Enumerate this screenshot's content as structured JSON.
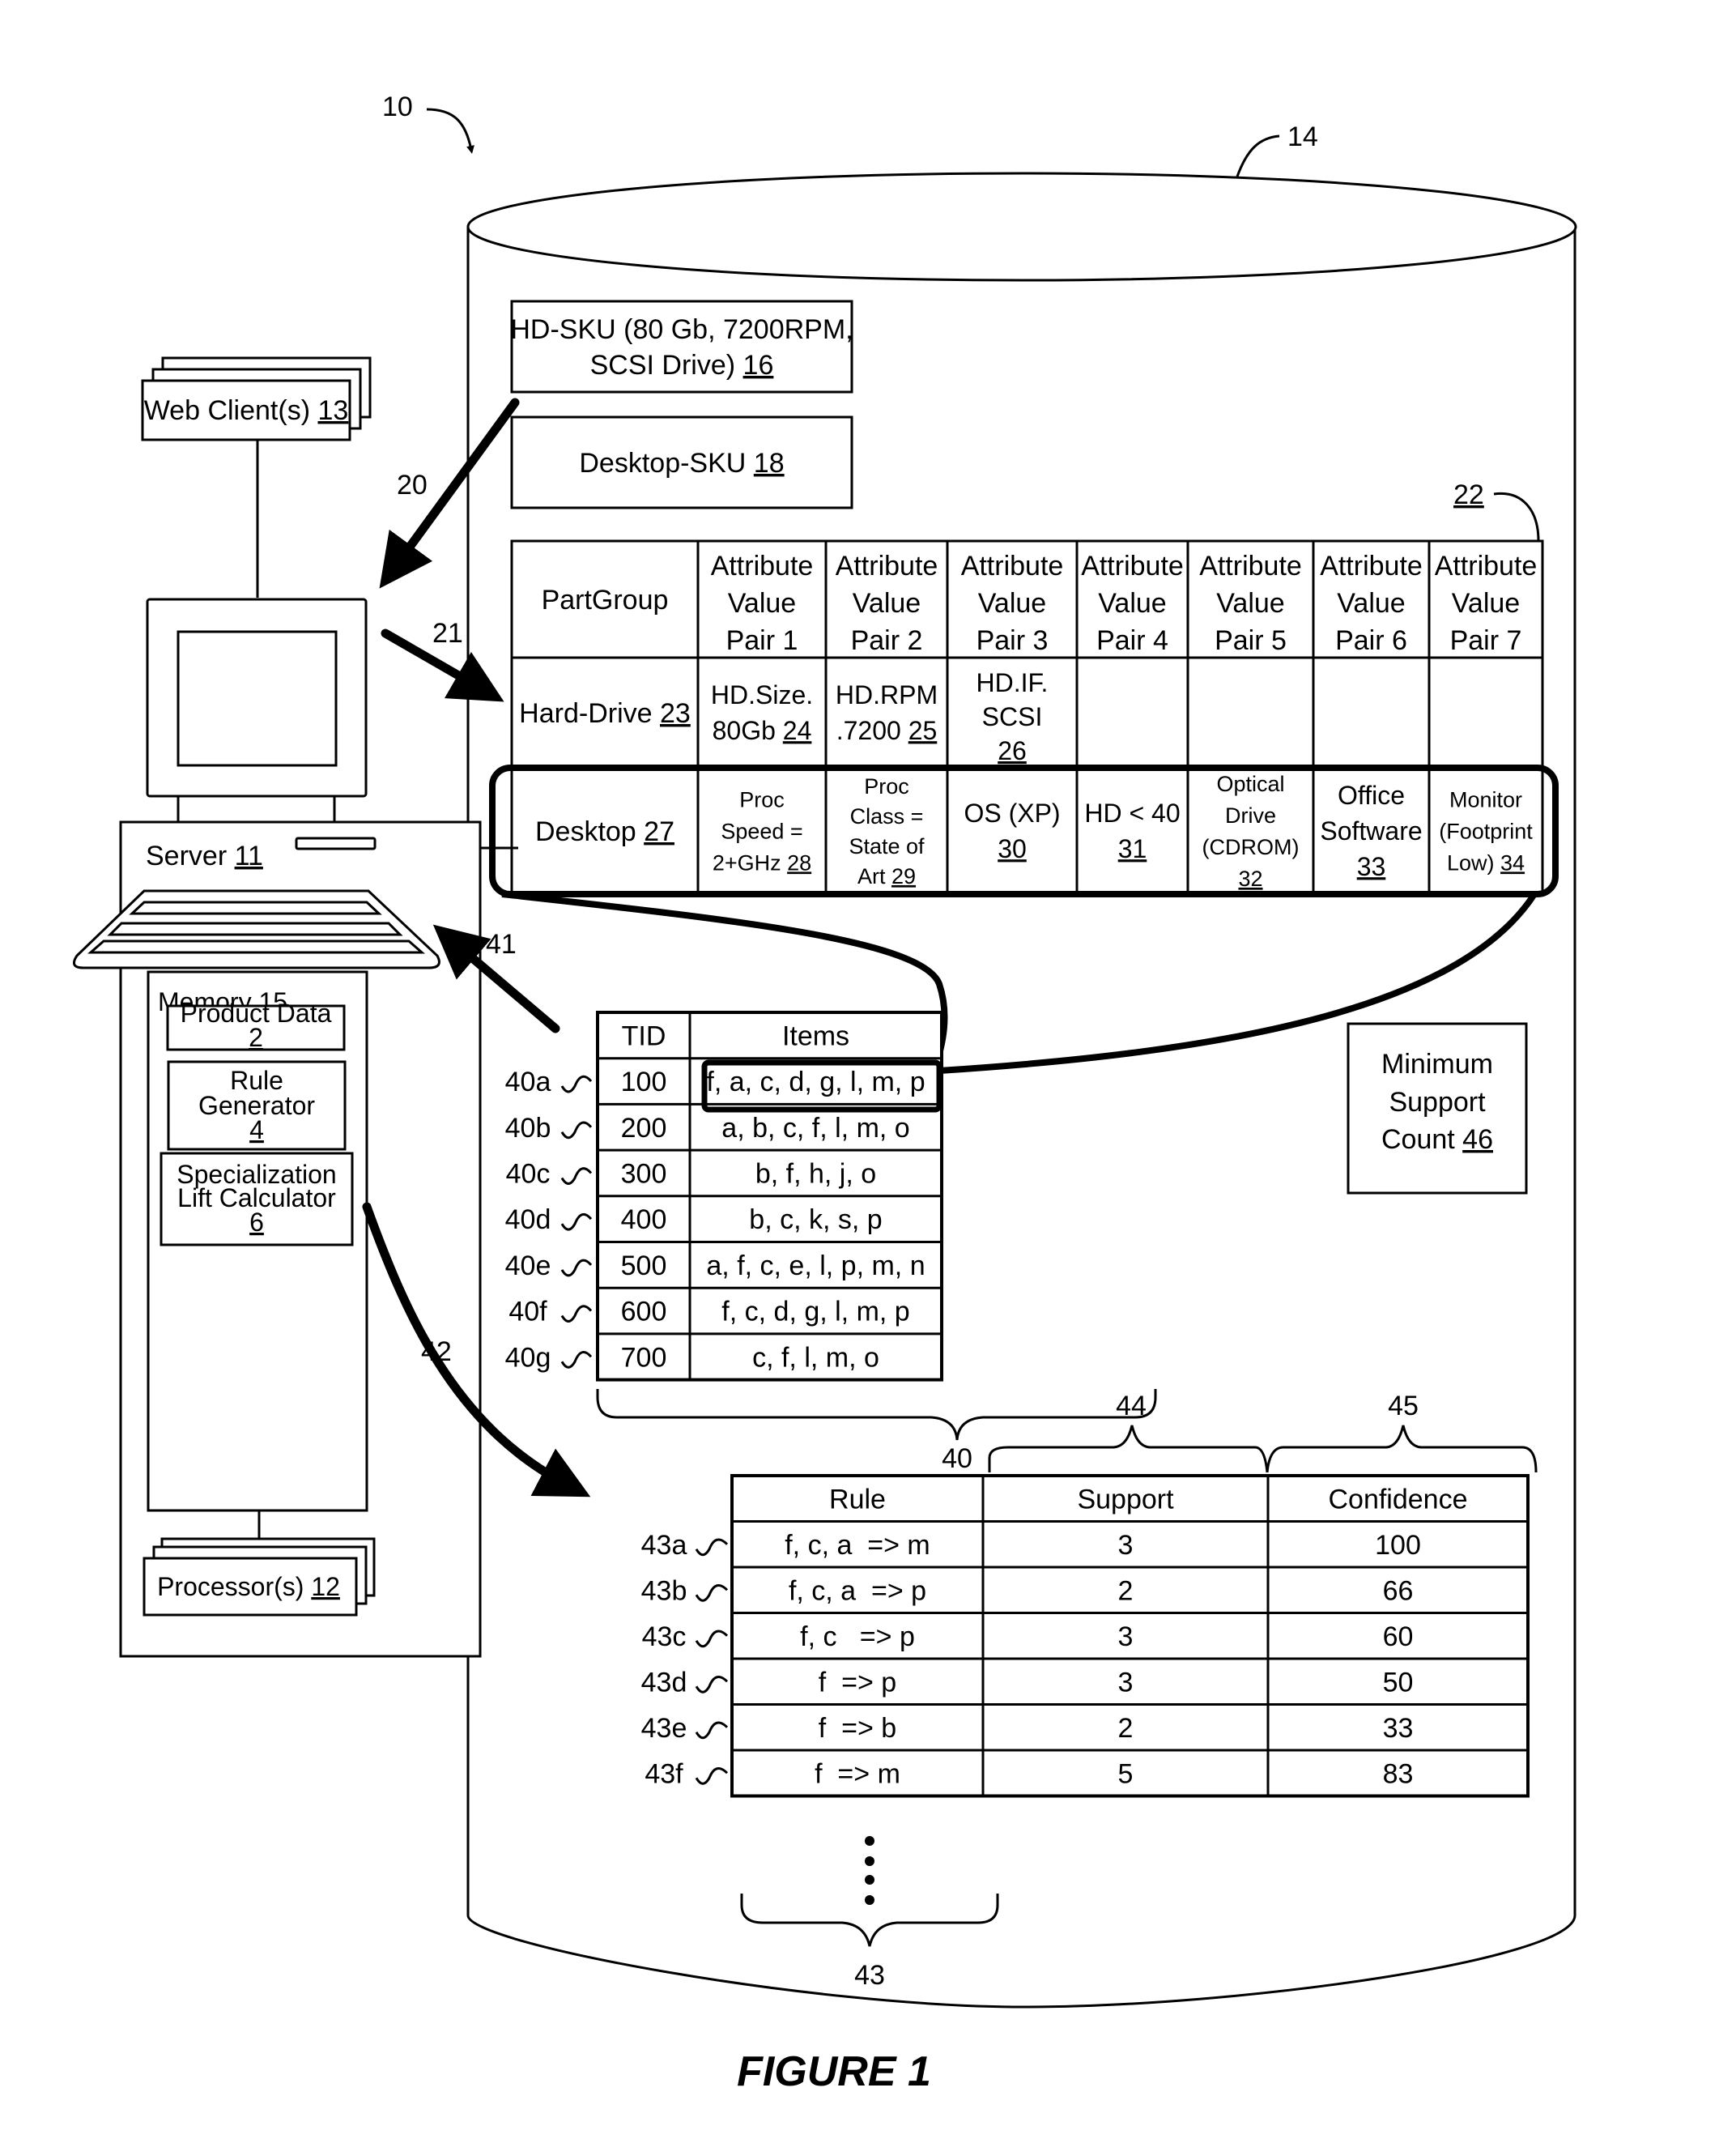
{
  "figure": {
    "caption": "FIGURE 1",
    "system_ref": "10",
    "database_ref": "14"
  },
  "left": {
    "web_clients": {
      "label": "Web Client(s)",
      "ref": "13"
    },
    "server": {
      "label": "Server",
      "ref": "11"
    },
    "memory": {
      "label": "Memory",
      "ref": "15"
    },
    "product_data": {
      "label": "Product Data",
      "ref": "2"
    },
    "rule_generator": {
      "line1": "Rule",
      "line2": "Generator",
      "ref": "4"
    },
    "lift_calculator": {
      "line1": "Specialization",
      "line2": "Lift Calculator",
      "ref": "6"
    },
    "processors": {
      "label": "Processor(s)",
      "ref": "12"
    }
  },
  "arrows": {
    "a20": "20",
    "a21": "21",
    "a41": "41",
    "a42": "42"
  },
  "skus": {
    "hd_sku": {
      "line1": "HD-SKU (80 Gb, 7200RPM,",
      "line2": "SCSI Drive)",
      "ref": "16"
    },
    "desktop_sku": {
      "label": "Desktop-SKU",
      "ref": "18"
    }
  },
  "partgroup_table": {
    "ref": "22",
    "header_first": "PartGroup",
    "headers": [
      [
        "Attribute",
        "Value",
        "Pair 1"
      ],
      [
        "Attribute",
        "Value",
        "Pair 2"
      ],
      [
        "Attribute",
        "Value",
        "Pair 3"
      ],
      [
        "Attribute",
        "Value",
        "Pair 4"
      ],
      [
        "Attribute",
        "Value",
        "Pair 5"
      ],
      [
        "Attribute",
        "Value",
        "Pair 6"
      ],
      [
        "Attribute",
        "Value",
        "Pair 7"
      ]
    ],
    "hard_drive": {
      "label": "Hard-Drive",
      "ref": "23",
      "cells": [
        {
          "lines": [
            "HD.Size.",
            "80Gb"
          ],
          "ref": "24"
        },
        {
          "lines": [
            "HD.RPM",
            ".7200"
          ],
          "ref": "25"
        },
        {
          "lines": [
            "HD.IF.",
            "SCSI"
          ],
          "ref": "26"
        }
      ]
    },
    "desktop": {
      "label": "Desktop",
      "ref": "27",
      "cells": [
        {
          "lines": [
            "Proc",
            "Speed =",
            "2+GHz"
          ],
          "ref": "28"
        },
        {
          "lines": [
            "Proc",
            "Class =",
            "State of",
            "Art"
          ],
          "ref": "29"
        },
        {
          "lines": [
            "OS (XP)"
          ],
          "ref": "30"
        },
        {
          "lines": [
            "HD < 40"
          ],
          "ref": "31"
        },
        {
          "lines": [
            "Optical",
            "Drive",
            "(CDROM)"
          ],
          "ref": "32"
        },
        {
          "lines": [
            "Office",
            "Software"
          ],
          "ref": "33"
        },
        {
          "lines": [
            "Monitor",
            "(Footprint",
            "Low)"
          ],
          "ref": "34"
        }
      ]
    }
  },
  "transactions": {
    "ref": "40",
    "headers": [
      "TID",
      "Items"
    ],
    "rows": [
      {
        "ref": "40a",
        "tid": "100",
        "items": "f, a, c, d, g, l, m, p"
      },
      {
        "ref": "40b",
        "tid": "200",
        "items": "a, b, c, f, l, m, o"
      },
      {
        "ref": "40c",
        "tid": "300",
        "items": "b, f, h, j, o"
      },
      {
        "ref": "40d",
        "tid": "400",
        "items": "b, c, k, s, p"
      },
      {
        "ref": "40e",
        "tid": "500",
        "items": "a, f, c, e, l, p, m, n"
      },
      {
        "ref": "40f",
        "tid": "600",
        "items": "f, c, d, g, l, m, p"
      },
      {
        "ref": "40g",
        "tid": "700",
        "items": "c, f, l, m, o"
      }
    ]
  },
  "min_support": {
    "line1": "Minimum",
    "line2": "Support",
    "line3": "Count",
    "ref": "46"
  },
  "rules": {
    "ref": "43",
    "support_ref": "44",
    "confidence_ref": "45",
    "headers": [
      "Rule",
      "Support",
      "Confidence"
    ],
    "rows": [
      {
        "ref": "43a",
        "rule": "f, c, a  => m",
        "support": "3",
        "confidence": "100"
      },
      {
        "ref": "43b",
        "rule": "f, c, a  => p",
        "support": "2",
        "confidence": "66"
      },
      {
        "ref": "43c",
        "rule": "f, c   => p",
        "support": "3",
        "confidence": "60"
      },
      {
        "ref": "43d",
        "rule": "f  => p",
        "support": "3",
        "confidence": "50"
      },
      {
        "ref": "43e",
        "rule": "f  => b",
        "support": "2",
        "confidence": "33"
      },
      {
        "ref": "43f",
        "rule": "f  => m",
        "support": "5",
        "confidence": "83"
      }
    ]
  }
}
